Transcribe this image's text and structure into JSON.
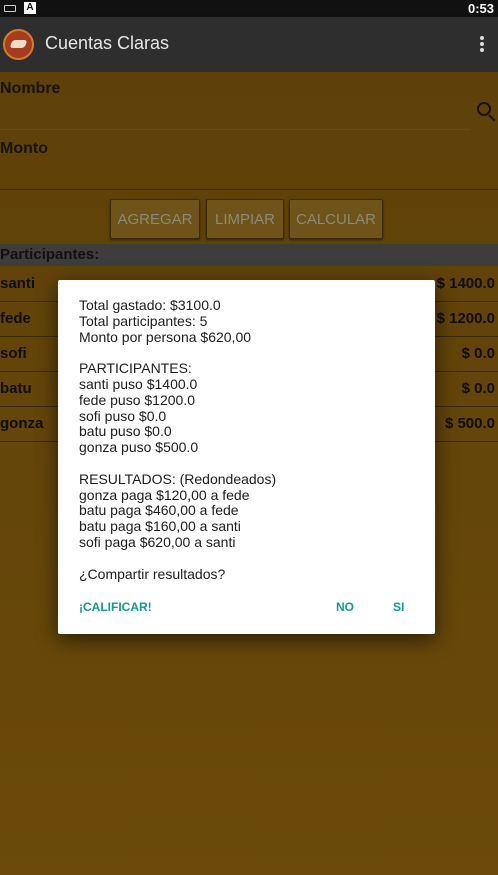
{
  "status_bar": {
    "time": "0:53",
    "notification_icon_label": "A"
  },
  "app_bar": {
    "title": "Cuentas Claras",
    "logo_icon": "app-logo-icon",
    "menu_icon": "overflow-menu-icon"
  },
  "form": {
    "nombre_label": "Nombre",
    "monto_label": "Monto",
    "nombre_value": "",
    "monto_value": ""
  },
  "buttons": {
    "agregar": "AGREGAR",
    "limpiar": "LIMPIAR",
    "calcular": "CALCULAR"
  },
  "participants": {
    "header": "Participantes:",
    "rows": [
      {
        "name": "santi",
        "amount": "$ 1400.0"
      },
      {
        "name": "fede",
        "amount": "$ 1200.0"
      },
      {
        "name": "sofi",
        "amount": "$ 0.0"
      },
      {
        "name": "batu",
        "amount": "$ 0.0"
      },
      {
        "name": "gonza",
        "amount": "$ 500.0"
      }
    ]
  },
  "dialog": {
    "lines": [
      "Total gastado: $3100.0",
      "Total participantes: 5",
      "Monto por persona $620,00",
      "",
      "PARTICIPANTES:",
      "santi puso $1400.0",
      "fede puso $1200.0",
      "sofi puso $0.0",
      "batu puso $0.0",
      "gonza puso $500.0",
      "",
      "RESULTADOS:  (Redondeados)",
      "gonza paga $120,00 a fede",
      "batu paga $460,00 a fede",
      "batu paga $160,00 a santi",
      "sofi paga $620,00 a santi",
      "",
      "¿Compartir resultados?"
    ],
    "actions": {
      "calificar": "¡CALIFICAR!",
      "no": "NO",
      "si": "SI"
    }
  },
  "colors": {
    "background": "#6b4a0a",
    "dialog_action": "#0e9c8e",
    "app_bar": "#2e2e2e"
  }
}
